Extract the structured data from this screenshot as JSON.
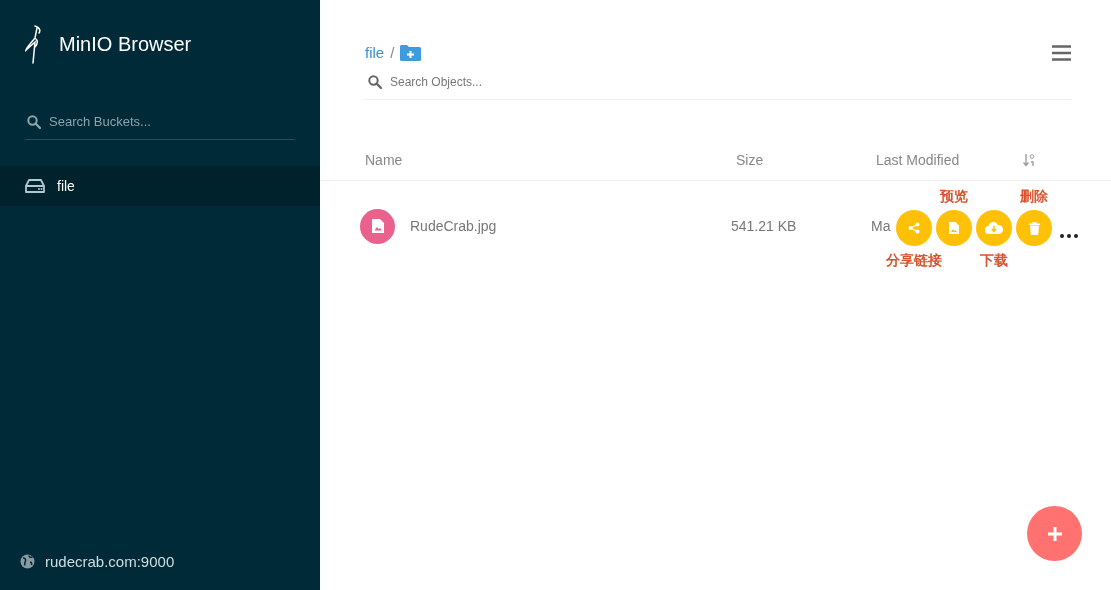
{
  "sidebar": {
    "title": "MinIO Browser",
    "search": {
      "placeholder": "Search Buckets..."
    },
    "buckets": [
      {
        "name": "file",
        "selected": true
      }
    ],
    "host": "rudecrab.com:9000"
  },
  "breadcrumb": {
    "path": "file",
    "separator": "/"
  },
  "search": {
    "placeholder": "Search Objects..."
  },
  "table": {
    "columns": [
      "Name",
      "Size",
      "Last Modified"
    ],
    "rows": [
      {
        "name": "RudeCrab.jpg",
        "size": "541.21 KB",
        "last_modified": "Ma",
        "actions": [
          {
            "kind": "share",
            "label_below": "分享链接"
          },
          {
            "kind": "preview",
            "label_above": "预览"
          },
          {
            "kind": "download",
            "label_below": "下载"
          },
          {
            "kind": "delete",
            "label_above": "删除"
          }
        ]
      }
    ]
  }
}
